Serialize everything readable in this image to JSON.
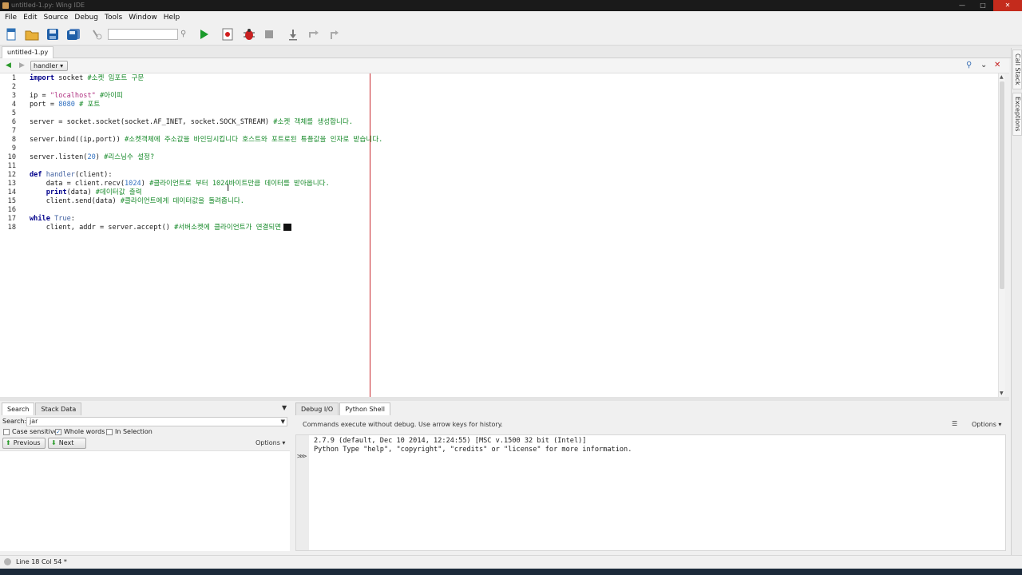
{
  "window": {
    "title": "untitled-1.py: Wing IDE"
  },
  "menu": [
    "File",
    "Edit",
    "Source",
    "Debug",
    "Tools",
    "Window",
    "Help"
  ],
  "toolbar": {
    "search_value": ""
  },
  "editor": {
    "tab_label": "untitled-1.py",
    "scope": "handler",
    "cursor_line": 18,
    "cursor_col": 54
  },
  "code_lines": [
    "import socket #소켓 임포트 구문",
    "",
    "ip = \"localhost\" #아이피",
    "port = 8080 # 포트",
    "",
    "server = socket.socket(socket.AF_INET, socket.SOCK_STREAM) #소켓 객체를 생성합니다.",
    "",
    "server.bind((ip,port)) #소켓객체에 주소값을 바인딩시킵니다 호스트와 포트로된 튜플값을 인자로 받습니다.",
    "",
    "server.listen(20) #리스닝수 설정?",
    "",
    "def handler(client):",
    "    data = client.recv(1024) #클라이언트로 부터 1024바이트만큼 데이터를 받아옵니다.",
    "    print(data) #데이터값 출력",
    "    client.send(data) #클라이언트에게 데이터값을 돌려줍니다.",
    "",
    "while True:",
    "    client, addr = server.accept() #서버소켓에 클라이언트가 연결되면"
  ],
  "line_numbers": [
    "1",
    "2",
    "3",
    "4",
    "5",
    "6",
    "7",
    "8",
    "9",
    "10",
    "11",
    "12",
    "13",
    "14",
    "15",
    "16",
    "17",
    "18"
  ],
  "side_tabs": {
    "call_stack": "Call Stack",
    "exceptions": "Exceptions"
  },
  "search_panel": {
    "tabs": [
      "Search",
      "Stack Data"
    ],
    "search_label": "Search:",
    "search_value": "jar",
    "case_sensitive": "Case sensitive",
    "whole_words": "Whole words",
    "in_selection": "In Selection",
    "whole_words_checked": true,
    "previous": "Previous",
    "next": "Next",
    "options": "Options"
  },
  "shell_panel": {
    "tabs": [
      "Debug I/O",
      "Python Shell"
    ],
    "info": "Commands execute without debug.  Use arrow keys for history.",
    "options": "Options",
    "output": [
      "2.7.9 (default, Dec 10 2014, 12:24:55) [MSC v.1500 32 bit (Intel)]",
      "Python Type \"help\", \"copyright\", \"credits\" or \"license\" for more information."
    ]
  },
  "status": {
    "text": "Line 18 Col 54 *"
  },
  "colors": {
    "edge_line": "#c8282d",
    "keyword": "#00008b",
    "string": "#b03080",
    "comment": "#178a2a",
    "number": "#3070c0"
  }
}
